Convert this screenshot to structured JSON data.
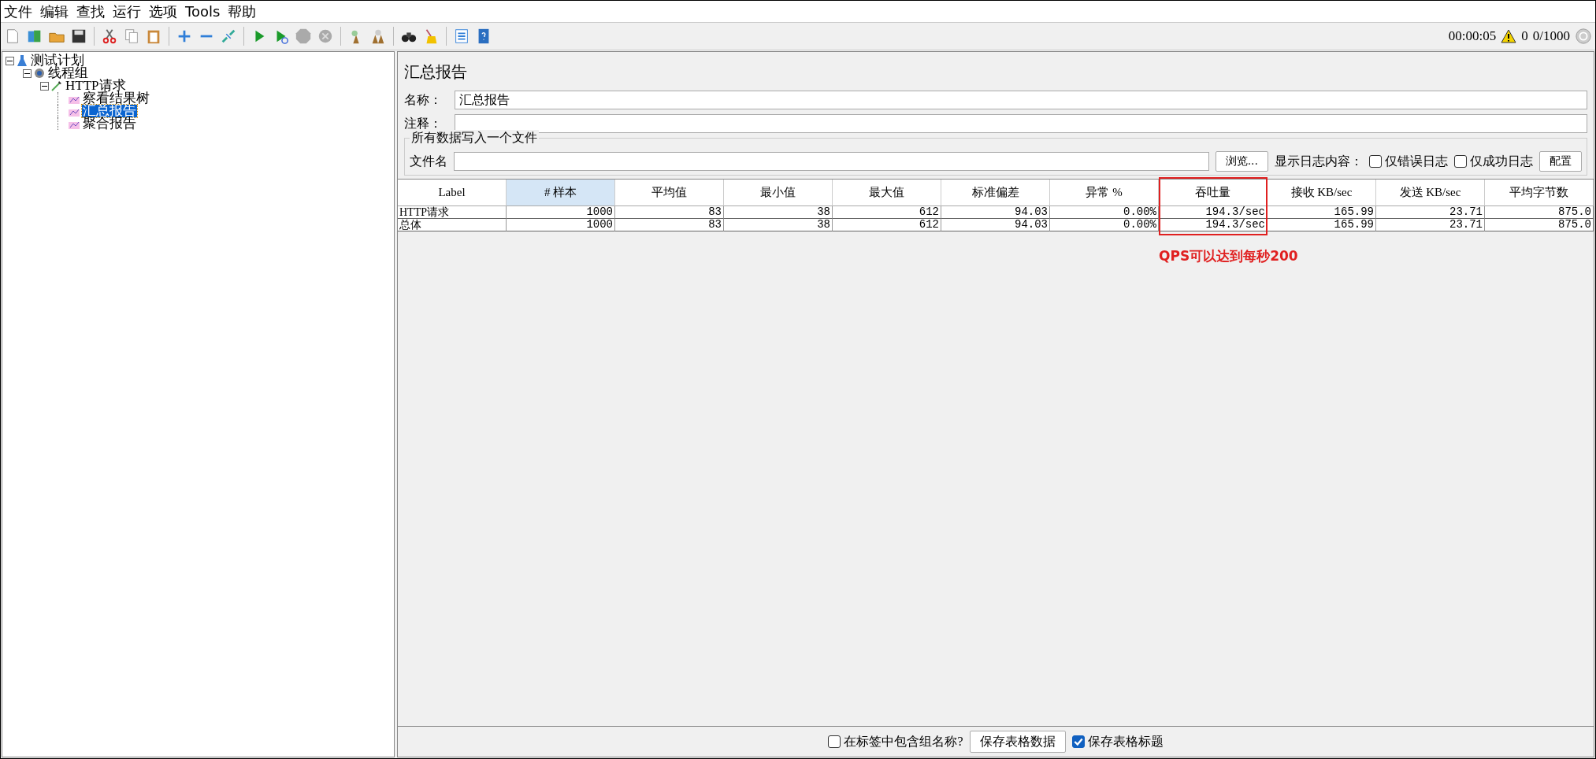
{
  "menu": [
    "文件",
    "编辑",
    "查找",
    "运行",
    "选项",
    "Tools",
    "帮助"
  ],
  "status": {
    "timer": "00:00:05",
    "warnings": "0",
    "threads": "0/1000"
  },
  "tree": [
    {
      "label": "测试计划",
      "kind": "plan",
      "expanded": true,
      "selected": false,
      "children": [
        {
          "label": "线程组",
          "kind": "threads",
          "expanded": true,
          "selected": false,
          "children": [
            {
              "label": "HTTP请求",
              "kind": "sampler",
              "expanded": true,
              "selected": false,
              "children": [
                {
                  "label": "察看结果树",
                  "kind": "listener",
                  "selected": false
                },
                {
                  "label": "汇总报告",
                  "kind": "listener",
                  "selected": true
                },
                {
                  "label": "聚合报告",
                  "kind": "listener",
                  "selected": false
                }
              ]
            }
          ]
        }
      ]
    }
  ],
  "panel": {
    "title": "汇总报告",
    "name_label": "名称：",
    "name_value": "汇总报告",
    "comment_label": "注释：",
    "file_group": {
      "legend": "所有数据写入一个文件",
      "file_label": "文件名",
      "browse_button": "浏览...",
      "log_label": "显示日志内容：",
      "checkboxes": [
        {
          "label": "仅错误日志",
          "checked": false
        },
        {
          "label": "仅成功日志",
          "checked": false
        }
      ],
      "config_button": "配置"
    }
  },
  "table": {
    "columns": [
      {
        "label": "Label",
        "selected": false,
        "highlighted": false
      },
      {
        "label": "# 样本",
        "selected": true,
        "highlighted": false
      },
      {
        "label": "平均值",
        "selected": false,
        "highlighted": false
      },
      {
        "label": "最小值",
        "selected": false,
        "highlighted": false
      },
      {
        "label": "最大值",
        "selected": false,
        "highlighted": false
      },
      {
        "label": "标准偏差",
        "selected": false,
        "highlighted": false
      },
      {
        "label": "异常 %",
        "selected": false,
        "highlighted": false
      },
      {
        "label": "吞吐量",
        "selected": false,
        "highlighted": true
      },
      {
        "label": "接收 KB/sec",
        "selected": false,
        "highlighted": false
      },
      {
        "label": "发送 KB/sec",
        "selected": false,
        "highlighted": false
      },
      {
        "label": "平均字节数",
        "selected": false,
        "highlighted": false
      }
    ],
    "rows": [
      [
        "HTTP请求",
        "1000",
        "83",
        "38",
        "612",
        "94.03",
        "0.00%",
        "194.3/sec",
        "165.99",
        "23.71",
        "875.0"
      ],
      [
        "总体",
        "1000",
        "83",
        "38",
        "612",
        "94.03",
        "0.00%",
        "194.3/sec",
        "165.99",
        "23.71",
        "875.0"
      ]
    ],
    "annotation": "QPS可以达到每秒200"
  },
  "bottom": {
    "group_checkbox": {
      "label": "在标签中包含组名称?",
      "checked": false
    },
    "save_button": "保存表格数据",
    "header_checkbox": {
      "label": "保存表格标题",
      "checked": true
    }
  }
}
